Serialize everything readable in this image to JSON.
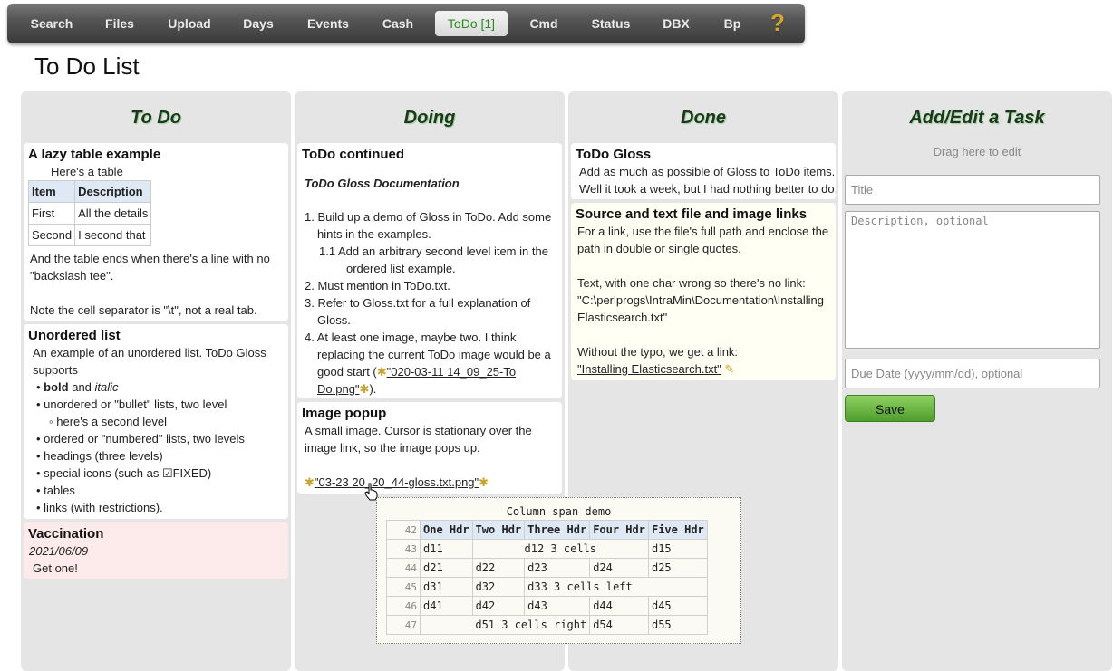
{
  "nav": {
    "items": [
      "Search",
      "Files",
      "Upload",
      "Days",
      "Events",
      "Cash",
      "ToDo [1]",
      "Cmd",
      "Status",
      "DBX",
      "Bp"
    ],
    "active": "ToDo [1]",
    "help": "?"
  },
  "page_title": "To Do List",
  "columns": {
    "todo": "To Do",
    "doing": "Doing",
    "done": "Done",
    "edit": "Add/Edit a Task"
  },
  "todo_cards": {
    "lazy": {
      "title": "A lazy table example",
      "intro": "Here's a table",
      "table": {
        "headers": [
          "Item",
          "Description"
        ],
        "rows": [
          [
            "First",
            "All the details"
          ],
          [
            "Second",
            "I second that"
          ]
        ]
      },
      "line1": "And the table ends when there's a line with no",
      "line2": "\"backslash tee\".",
      "line3": "Note the cell separator is \"\\t\", not a real tab."
    },
    "unordered": {
      "title": "Unordered list",
      "line1": "An example of an unordered list. ToDo Gloss",
      "line2": "supports",
      "b1_bold": "bold",
      "b1_and": " and ",
      "b1_italic": "italic",
      "b2": "unordered or \"bullet\" lists, two level",
      "b2a": "here's a second level",
      "b3": "ordered or \"numbered\" lists, two levels",
      "b4": "headings (three levels)",
      "b5": "special icons (such as ☑FIXED)",
      "b6": "tables",
      "b7": "links (with restrictions)."
    },
    "vaccination": {
      "title": "Vaccination",
      "date": "2021/06/09",
      "text": "Get one!"
    }
  },
  "doing_cards": {
    "continued": {
      "title": "ToDo continued",
      "heading": "ToDo Gloss Documentation",
      "i1a": "1. Build up a demo of Gloss in ToDo. Add some",
      "i1b": "hints in the examples.",
      "i11a": "1.1 Add an arbitrary second level item in the",
      "i11b": "ordered list example.",
      "i2": "2. Must mention in ToDo.txt.",
      "i3a": "3. Refer to Gloss.txt for a full explanation of",
      "i3b": "Gloss.",
      "i4a": "4. At least one image, maybe two. I think",
      "i4b": "replacing the current ToDo image would be a",
      "i4c_pre": "good start (",
      "i4c_link": "\"020-03-11 14_09_25-To",
      "i4d_link": "Do.png\"",
      "i4d_post": ")."
    },
    "popup_card": {
      "title": "Image popup",
      "line1": "A small image. Cursor is stationary over the",
      "line2": "image link, so the image pops up.",
      "link": "\"03-23 20_20_44-gloss.txt.png\""
    }
  },
  "done_cards": {
    "gloss": {
      "title": "ToDo Gloss",
      "line1": "Add as much as possible of Gloss to ToDo items.",
      "line2": "Well it took a week, but I had nothing better to do."
    },
    "source": {
      "title": "Source and text file and image links",
      "line1": "For a link, use the file's full path and enclose the",
      "line2": "path in double or single quotes.",
      "line3": "Text, with one char wrong so there's no link:",
      "line4": "\"C:\\perlprogs\\IntraMin\\Documentation\\Installing",
      "line5": "Elasticsearch.txt\"",
      "line6": "Without the typo, we get a link:",
      "link": "\"Installing Elasticsearch.txt\""
    }
  },
  "edit": {
    "drag_hint": "Drag here to edit",
    "title_placeholder": "Title",
    "desc_placeholder": "Description, optional",
    "due_placeholder": "Due Date (yyyy/mm/dd), optional",
    "save_label": "Save"
  },
  "popup": {
    "title": "Column span demo",
    "headers": [
      "One Hdr",
      "Two Hdr",
      "Three Hdr",
      "Four Hdr",
      "Five Hdr"
    ],
    "header_line": "42",
    "lines": [
      "43",
      "44",
      "45",
      "46",
      "47"
    ],
    "r43": [
      "d11",
      "d12 3 cells",
      "d15"
    ],
    "r44": [
      "d21",
      "d22",
      "d23",
      "d24",
      "d25"
    ],
    "r45": [
      "d31",
      "d32",
      "d33 3 cells left"
    ],
    "r46": [
      "d41",
      "d42",
      "d43",
      "d44",
      "d45"
    ],
    "r47": [
      "d51 3 cells right",
      "d54",
      "d55"
    ]
  },
  "colors": {
    "accent_green": "#2a8a1e",
    "save_green": "#5fae36",
    "column_bg": "#e5e5e5"
  }
}
